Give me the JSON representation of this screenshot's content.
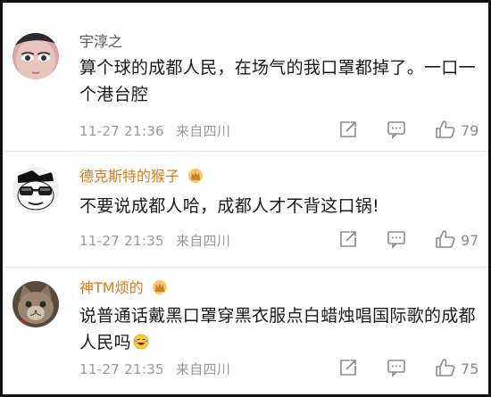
{
  "comments": [
    {
      "username": "宇淳之",
      "text": "算个球的成都人民，在场气的我口罩都掉了。一口一个港台腔",
      "date": "11-27 21:36",
      "location": "来自四川",
      "likes": "79",
      "avatar_icon": "woman-eyes-avatar",
      "name_color": "#555555"
    },
    {
      "username": "德克斯特的猴子",
      "text": "不要说成都人哈，成都人才不背这口锅!",
      "date": "11-27 21:35",
      "location": "来自四川",
      "likes": "97",
      "avatar_icon": "cartoon-glasses-avatar",
      "name_color": "#e07a14"
    },
    {
      "username": "神TM烦的",
      "text": "说普通话戴黑口罩穿黑衣服点白蜡烛唱国际歌的成都人民吗",
      "date": "11-27 21:35",
      "location": "来自四川",
      "likes": "75",
      "avatar_icon": "cat-avatar",
      "name_color": "#e07a14"
    }
  ],
  "icons": {
    "share": "share-edit-icon",
    "reply": "comment-bubble-icon",
    "like": "thumb-up-icon",
    "badge": "vip-crown-badge-icon",
    "emoji": "laughing-emoji-icon"
  }
}
